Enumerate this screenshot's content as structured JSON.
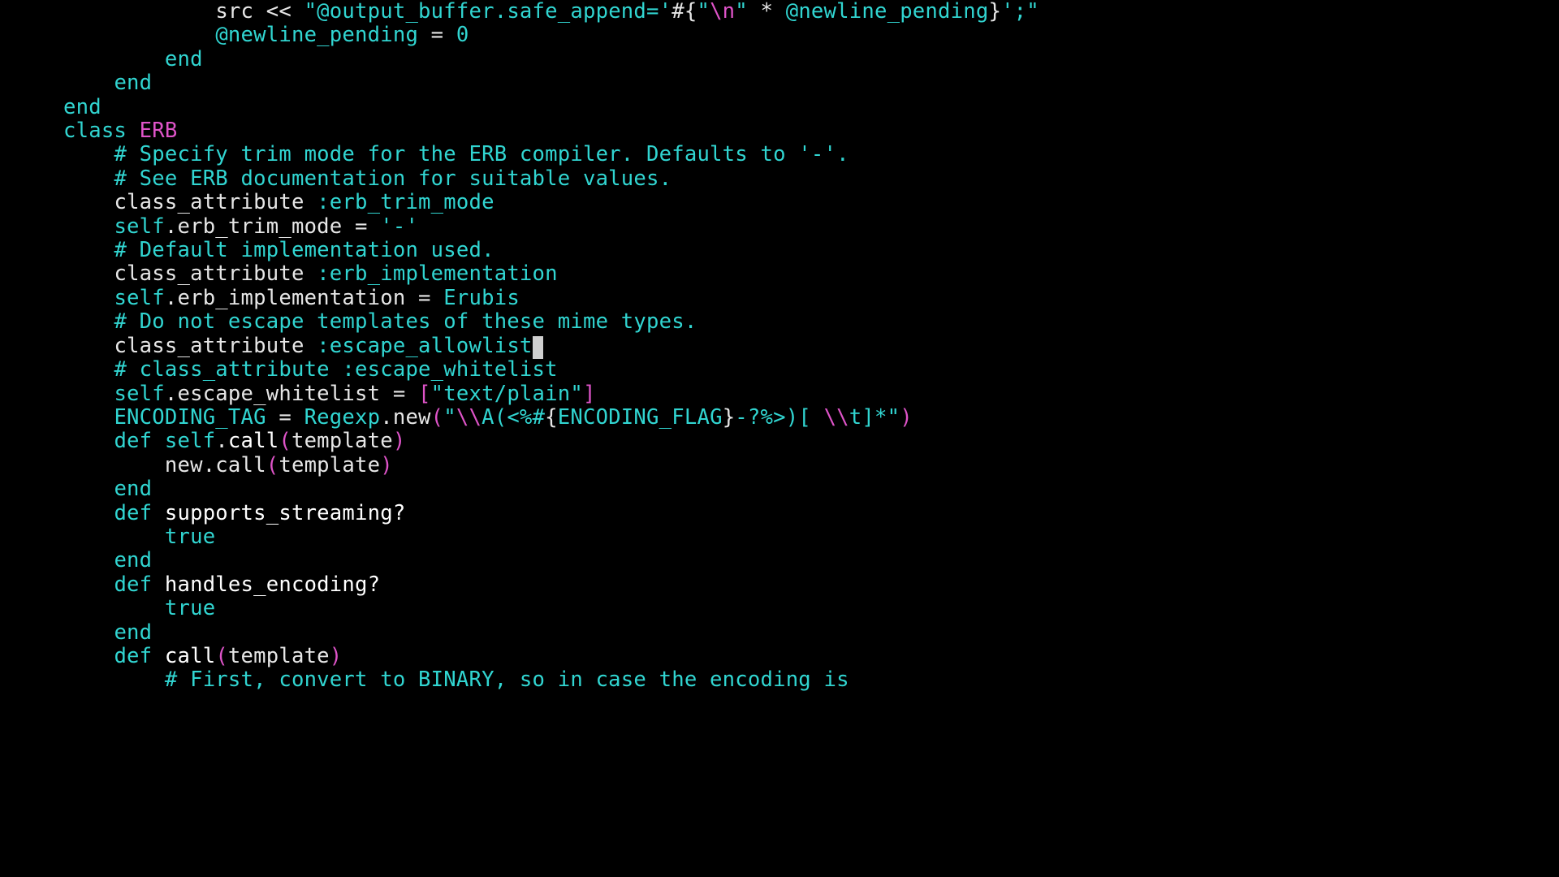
{
  "colors": {
    "background": "#000000",
    "default": "#e6e6e6",
    "cyan": "#31d5d1",
    "magenta": "#df54c9",
    "white": "#ffffff",
    "cursor": "#cfcfcf"
  },
  "cursor_line_index": 17,
  "lines": [
    {
      "indent": 6,
      "tokens": [
        {
          "t": "src << ",
          "c": "default"
        },
        {
          "t": "\"@output_buffer.safe_append='",
          "c": "cyan"
        },
        {
          "t": "#{",
          "c": "default"
        },
        {
          "t": "\"",
          "c": "cyan"
        },
        {
          "t": "\\n",
          "c": "magenta"
        },
        {
          "t": "\"",
          "c": "cyan"
        },
        {
          "t": " * ",
          "c": "default"
        },
        {
          "t": "@newline_pending",
          "c": "cyan"
        },
        {
          "t": "}",
          "c": "default"
        },
        {
          "t": "';\"",
          "c": "cyan"
        }
      ]
    },
    {
      "indent": 6,
      "tokens": [
        {
          "t": "@newline_pending",
          "c": "cyan"
        },
        {
          "t": " = ",
          "c": "default"
        },
        {
          "t": "0",
          "c": "cyan"
        }
      ]
    },
    {
      "indent": 4,
      "tokens": [
        {
          "t": "end",
          "c": "cyan"
        }
      ]
    },
    {
      "indent": 2,
      "tokens": [
        {
          "t": "end",
          "c": "cyan"
        }
      ]
    },
    {
      "indent": 0,
      "tokens": [
        {
          "t": "end",
          "c": "cyan"
        }
      ]
    },
    {
      "indent": 0,
      "tokens": []
    },
    {
      "indent": 0,
      "tokens": [
        {
          "t": "class",
          "c": "cyan"
        },
        {
          "t": " ",
          "c": "default"
        },
        {
          "t": "ERB",
          "c": "magenta"
        }
      ]
    },
    {
      "indent": 2,
      "tokens": [
        {
          "t": "# Specify trim mode for the ERB compiler. Defaults to '-'.",
          "c": "cyan"
        }
      ]
    },
    {
      "indent": 2,
      "tokens": [
        {
          "t": "# See ERB documentation for suitable values.",
          "c": "cyan"
        }
      ]
    },
    {
      "indent": 2,
      "tokens": [
        {
          "t": "class_attribute ",
          "c": "default"
        },
        {
          "t": ":erb_trim_mode",
          "c": "cyan"
        }
      ]
    },
    {
      "indent": 2,
      "tokens": [
        {
          "t": "self",
          "c": "cyan"
        },
        {
          "t": ".erb_trim_mode = ",
          "c": "default"
        },
        {
          "t": "'-'",
          "c": "cyan"
        }
      ]
    },
    {
      "indent": 0,
      "tokens": []
    },
    {
      "indent": 2,
      "tokens": [
        {
          "t": "# Default implementation used.",
          "c": "cyan"
        }
      ]
    },
    {
      "indent": 2,
      "tokens": [
        {
          "t": "class_attribute ",
          "c": "default"
        },
        {
          "t": ":erb_implementation",
          "c": "cyan"
        }
      ]
    },
    {
      "indent": 2,
      "tokens": [
        {
          "t": "self",
          "c": "cyan"
        },
        {
          "t": ".erb_implementation = ",
          "c": "default"
        },
        {
          "t": "Erubis",
          "c": "cyan"
        }
      ]
    },
    {
      "indent": 0,
      "tokens": []
    },
    {
      "indent": 2,
      "tokens": [
        {
          "t": "# Do not escape templates of these mime types.",
          "c": "cyan"
        }
      ]
    },
    {
      "indent": 2,
      "tokens": [
        {
          "t": "class_attribute ",
          "c": "default"
        },
        {
          "t": ":escape_allowlist",
          "c": "cyan"
        }
      ]
    },
    {
      "indent": 2,
      "tokens": [
        {
          "t": "# class_attribute :escape_whitelist",
          "c": "cyan"
        }
      ]
    },
    {
      "indent": 2,
      "tokens": [
        {
          "t": "self",
          "c": "cyan"
        },
        {
          "t": ".escape_whitelist = ",
          "c": "default"
        },
        {
          "t": "[",
          "c": "magenta"
        },
        {
          "t": "\"text/plain\"",
          "c": "cyan"
        },
        {
          "t": "]",
          "c": "magenta"
        }
      ]
    },
    {
      "indent": 0,
      "tokens": []
    },
    {
      "indent": 2,
      "tokens": [
        {
          "t": "ENCODING_TAG",
          "c": "cyan"
        },
        {
          "t": " = ",
          "c": "default"
        },
        {
          "t": "Regexp",
          "c": "cyan"
        },
        {
          "t": ".new",
          "c": "default"
        },
        {
          "t": "(",
          "c": "magenta"
        },
        {
          "t": "\"",
          "c": "cyan"
        },
        {
          "t": "\\\\",
          "c": "magenta"
        },
        {
          "t": "A(<%#",
          "c": "cyan"
        },
        {
          "t": "{",
          "c": "default"
        },
        {
          "t": "ENCODING_FLAG",
          "c": "cyan"
        },
        {
          "t": "}",
          "c": "default"
        },
        {
          "t": "-?%>)[ ",
          "c": "cyan"
        },
        {
          "t": "\\\\",
          "c": "magenta"
        },
        {
          "t": "t]*\"",
          "c": "cyan"
        },
        {
          "t": ")",
          "c": "magenta"
        }
      ]
    },
    {
      "indent": 0,
      "tokens": []
    },
    {
      "indent": 2,
      "tokens": [
        {
          "t": "def",
          "c": "cyan"
        },
        {
          "t": " ",
          "c": "default"
        },
        {
          "t": "self",
          "c": "cyan"
        },
        {
          "t": ".",
          "c": "default"
        },
        {
          "t": "call",
          "c": "white"
        },
        {
          "t": "(",
          "c": "magenta"
        },
        {
          "t": "template",
          "c": "default"
        },
        {
          "t": ")",
          "c": "magenta"
        }
      ]
    },
    {
      "indent": 4,
      "tokens": [
        {
          "t": "new.call",
          "c": "default"
        },
        {
          "t": "(",
          "c": "magenta"
        },
        {
          "t": "template",
          "c": "default"
        },
        {
          "t": ")",
          "c": "magenta"
        }
      ]
    },
    {
      "indent": 2,
      "tokens": [
        {
          "t": "end",
          "c": "cyan"
        }
      ]
    },
    {
      "indent": 0,
      "tokens": []
    },
    {
      "indent": 2,
      "tokens": [
        {
          "t": "def",
          "c": "cyan"
        },
        {
          "t": " ",
          "c": "default"
        },
        {
          "t": "supports_streaming?",
          "c": "white"
        }
      ]
    },
    {
      "indent": 4,
      "tokens": [
        {
          "t": "true",
          "c": "cyan"
        }
      ]
    },
    {
      "indent": 2,
      "tokens": [
        {
          "t": "end",
          "c": "cyan"
        }
      ]
    },
    {
      "indent": 0,
      "tokens": []
    },
    {
      "indent": 2,
      "tokens": [
        {
          "t": "def",
          "c": "cyan"
        },
        {
          "t": " ",
          "c": "default"
        },
        {
          "t": "handles_encoding?",
          "c": "white"
        }
      ]
    },
    {
      "indent": 4,
      "tokens": [
        {
          "t": "true",
          "c": "cyan"
        }
      ]
    },
    {
      "indent": 2,
      "tokens": [
        {
          "t": "end",
          "c": "cyan"
        }
      ]
    },
    {
      "indent": 0,
      "tokens": []
    },
    {
      "indent": 2,
      "tokens": [
        {
          "t": "def",
          "c": "cyan"
        },
        {
          "t": " ",
          "c": "default"
        },
        {
          "t": "call",
          "c": "white"
        },
        {
          "t": "(",
          "c": "magenta"
        },
        {
          "t": "template",
          "c": "default"
        },
        {
          "t": ")",
          "c": "magenta"
        }
      ]
    },
    {
      "indent": 4,
      "tokens": [
        {
          "t": "# First, convert to BINARY, so in case the encoding is",
          "c": "cyan"
        }
      ]
    }
  ]
}
